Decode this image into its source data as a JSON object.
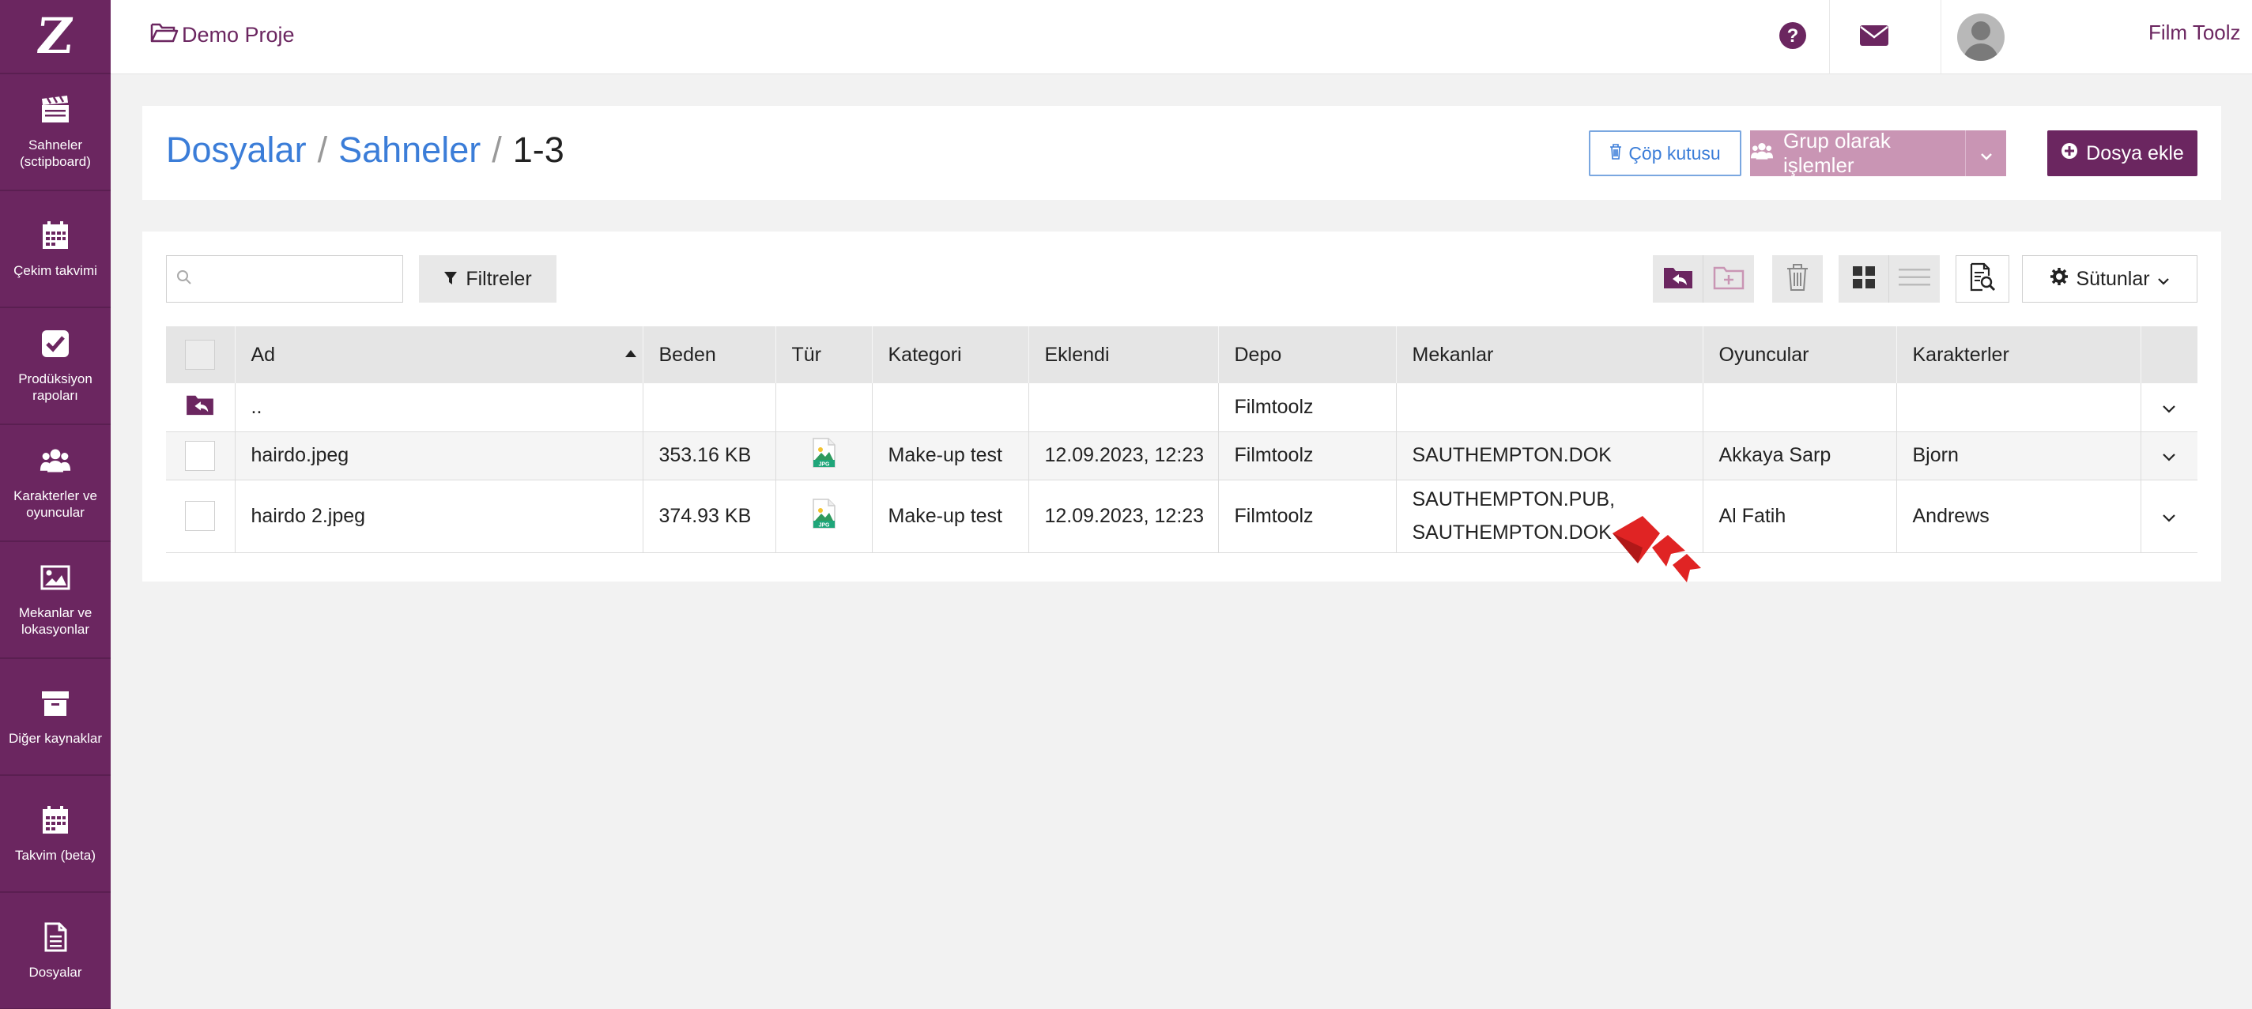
{
  "app": {
    "logo_text": "Z"
  },
  "sidebar": {
    "items": [
      {
        "label": "Sahneler (sctipboard)",
        "icon": "clapperboard-icon"
      },
      {
        "label": "Çekim takvimi",
        "icon": "calendar-icon"
      },
      {
        "label": "Prodüksiyon rapoları",
        "icon": "checkbox-icon"
      },
      {
        "label": "Karakterler ve oyuncular",
        "icon": "users-icon"
      },
      {
        "label": "Mekanlar ve lokasyonlar",
        "icon": "image-icon"
      },
      {
        "label": "Diğer kaynaklar",
        "icon": "archive-icon"
      },
      {
        "label": "Takvim (beta)",
        "icon": "calendar-icon"
      },
      {
        "label": "Dosyalar",
        "icon": "document-icon"
      }
    ]
  },
  "topbar": {
    "project": "Demo Proje",
    "user_name": "Film Toolz",
    "lang": "TR"
  },
  "breadcrumb": {
    "items": [
      "Dosyalar",
      "Sahneler"
    ],
    "current": "1-3",
    "separator": "/"
  },
  "actions": {
    "trash": "Çöp kutusu",
    "group": "Grup olarak işlemler",
    "add": "Dosya ekle"
  },
  "toolbar": {
    "search_placeholder": "",
    "filters": "Filtreler",
    "columns": "Sütunlar"
  },
  "table": {
    "headers": [
      "Ad",
      "Beden",
      "Tür",
      "Kategori",
      "Eklendi",
      "Depo",
      "Mekanlar",
      "Oyuncular",
      "Karakterler"
    ],
    "parent_row": {
      "name": "..",
      "depot": "Filmtoolz"
    },
    "rows": [
      {
        "name": "hairdo.jpeg",
        "size": "353.16 KB",
        "type": "JPG",
        "category": "Make-up test",
        "added": "12.09.2023, 12:23",
        "depot": "Filmtoolz",
        "locations": [
          "SAUTHEMPTON.DOK"
        ],
        "actors": "Akkaya Sarp",
        "characters": "Bjorn"
      },
      {
        "name": "hairdo 2.jpeg",
        "size": "374.93 KB",
        "type": "JPG",
        "category": "Make-up test",
        "added": "12.09.2023, 12:23",
        "depot": "Filmtoolz",
        "locations": [
          "SAUTHEMPTON.PUB,",
          "SAUTHEMPTON.DOK"
        ],
        "actors": "Al Fatih",
        "characters": "Andrews"
      }
    ]
  },
  "colors": {
    "brand": "#6b2660",
    "link": "#3b7dd8",
    "group_button": "#c995b4",
    "cursor": "#e02424"
  }
}
